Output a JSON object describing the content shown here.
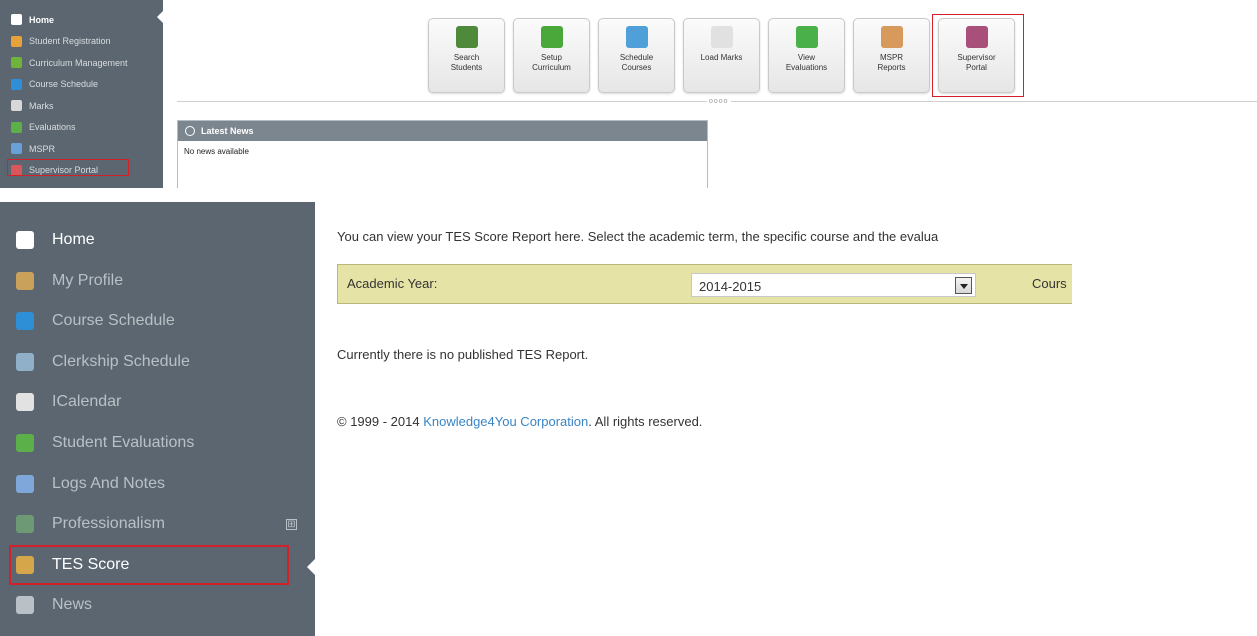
{
  "top": {
    "sidebar": {
      "items": [
        {
          "label": "Home",
          "icon": "home-icon",
          "color": "#ffffff"
        },
        {
          "label": "Student Registration",
          "icon": "students-icon",
          "color": "#e8a23a"
        },
        {
          "label": "Curriculum Management",
          "icon": "grid-icon",
          "color": "#6fb33a"
        },
        {
          "label": "Course Schedule",
          "icon": "schedule-icon",
          "color": "#2f8fd6"
        },
        {
          "label": "Marks",
          "icon": "marks-icon",
          "color": "#d8d8d8"
        },
        {
          "label": "Evaluations",
          "icon": "evaluation-icon",
          "color": "#5cb04a"
        },
        {
          "label": "MSPR",
          "icon": "mspr-icon",
          "color": "#6aa0d8"
        },
        {
          "label": "Supervisor Portal",
          "icon": "supervisor-icon",
          "color": "#d9575b"
        }
      ],
      "selected": "Supervisor Portal"
    },
    "toolbar": {
      "buttons": [
        {
          "label": "Search\nStudents",
          "icon": "search-students-icon",
          "color": "#4e8a3a"
        },
        {
          "label": "Setup\nCurriculum",
          "icon": "setup-curriculum-icon",
          "color": "#4aa83a"
        },
        {
          "label": "Schedule\nCourses",
          "icon": "calendar-icon",
          "color": "#4f9fd8"
        },
        {
          "label": "Load Marks",
          "icon": "load-marks-icon",
          "color": "#e1e1e1"
        },
        {
          "label": "View\nEvaluations",
          "icon": "view-evaluations-icon",
          "color": "#4ab04a"
        },
        {
          "label": "MSPR\nReports",
          "icon": "mspr-reports-icon",
          "color": "#d79a5c"
        },
        {
          "label": "Supervisor\nPortal",
          "icon": "supervisor-portal-icon",
          "color": "#a8507a"
        }
      ],
      "selected": "Supervisor\nPortal"
    },
    "handle": "oooo",
    "news": {
      "title": "Latest News",
      "body": "No news available"
    }
  },
  "bottom": {
    "sidebar": {
      "items": [
        {
          "label": "Home",
          "icon": "home-icon",
          "color": "#ffffff"
        },
        {
          "label": "My Profile",
          "icon": "profile-icon",
          "color": "#c9a15a"
        },
        {
          "label": "Course Schedule",
          "icon": "schedule-icon",
          "color": "#2f8fd6"
        },
        {
          "label": "Clerkship Schedule",
          "icon": "clerkship-icon",
          "color": "#8fb0c8"
        },
        {
          "label": "ICalendar",
          "icon": "icalendar-icon",
          "color": "#e2e2e2"
        },
        {
          "label": "Student Evaluations",
          "icon": "evaluations-icon",
          "color": "#5cb04a"
        },
        {
          "label": "Logs And Notes",
          "icon": "notes-icon",
          "color": "#7fa7d9"
        },
        {
          "label": "Professionalism",
          "icon": "professionalism-icon",
          "color": "#6d9a74",
          "expand": "⊞"
        },
        {
          "label": "TES Score",
          "icon": "tes-score-icon",
          "color": "#d6a64a"
        },
        {
          "label": "News",
          "icon": "news-icon",
          "color": "#b9c0c6"
        }
      ],
      "selected": "TES Score"
    },
    "intro": "You can view your TES Score Report here. Select the academic term, the specific course and the evalua",
    "filter": {
      "academic_year_label": "Academic Year:",
      "academic_year_value": "2014-2015",
      "course_label": "Cours"
    },
    "no_report": "Currently there is no published TES Report.",
    "footer": {
      "prefix": "© 1999 - 2014 ",
      "link": "Knowledge4You Corporation",
      "suffix": ". All rights reserved."
    }
  }
}
